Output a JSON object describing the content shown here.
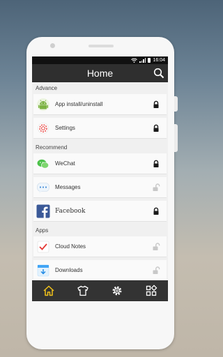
{
  "status": {
    "time": "16:04"
  },
  "header": {
    "title": "Home"
  },
  "sections": [
    {
      "title": "Advance",
      "items": [
        {
          "label": "App install/uninstall",
          "icon": "android-icon",
          "locked": true
        },
        {
          "label": "Settings",
          "icon": "settings-app-icon",
          "locked": true
        }
      ]
    },
    {
      "title": "Recommend",
      "items": [
        {
          "label": "WeChat",
          "icon": "wechat-icon",
          "locked": true
        },
        {
          "label": "Messages",
          "icon": "messages-icon",
          "locked": false
        },
        {
          "label": "Facebook",
          "icon": "facebook-icon",
          "locked": true
        }
      ]
    },
    {
      "title": "Apps",
      "items": [
        {
          "label": "Cloud Notes",
          "icon": "cloud-notes-icon",
          "locked": false
        },
        {
          "label": "Downloads",
          "icon": "downloads-icon",
          "locked": false
        }
      ]
    }
  ],
  "tabs": [
    {
      "name": "home",
      "icon": "home-icon",
      "active": true
    },
    {
      "name": "theme",
      "icon": "tshirt-icon",
      "active": false
    },
    {
      "name": "settings",
      "icon": "gear-icon",
      "active": false
    },
    {
      "name": "more",
      "icon": "grid-icon",
      "active": false
    }
  ],
  "colors": {
    "accent": "#f1c21b",
    "lock_on": "#1a1a1a",
    "lock_off": "#c8c8c8",
    "header": "#2f2f2f"
  }
}
